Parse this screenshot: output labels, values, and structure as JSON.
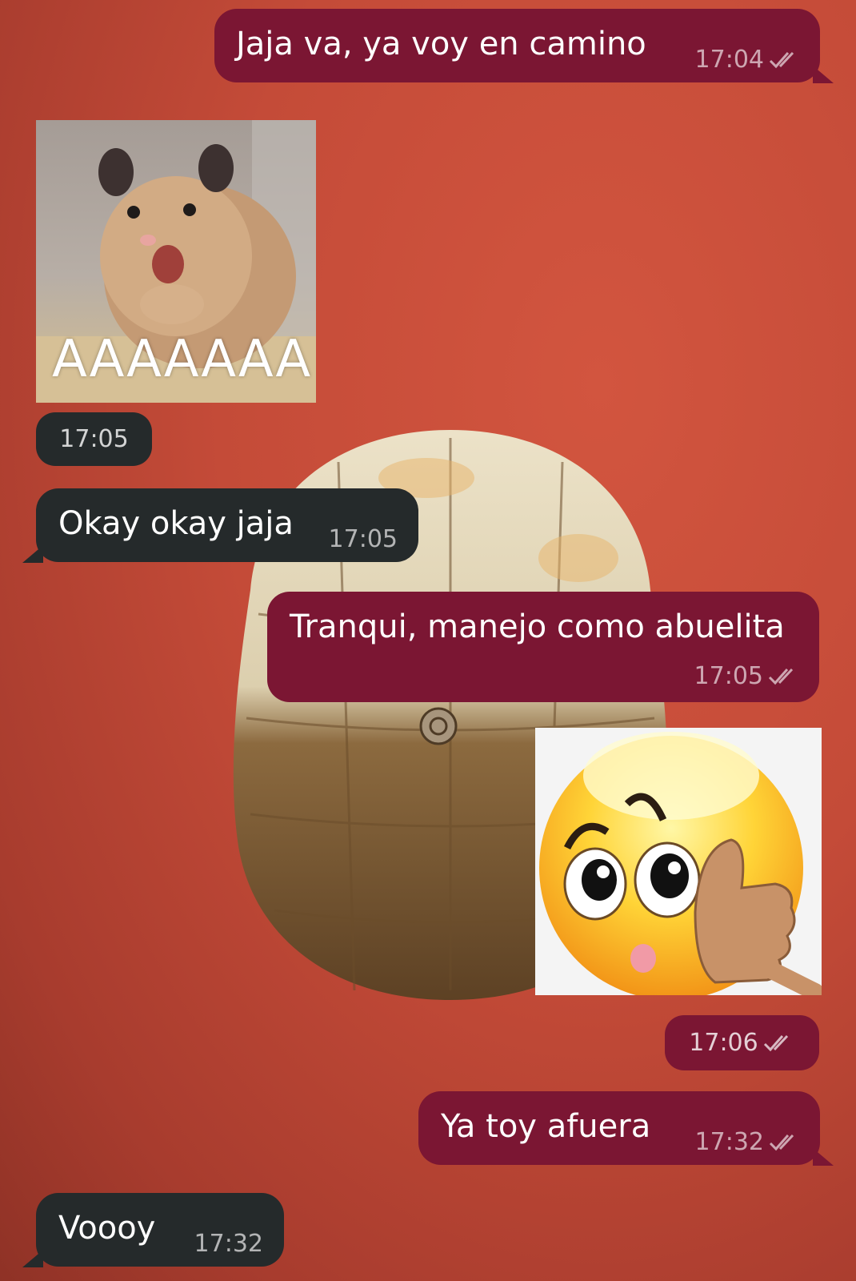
{
  "colors": {
    "outgoing_bubble": "#7b1633",
    "incoming_bubble": "#252a2b",
    "wallpaper": "#c44b38"
  },
  "messages": [
    {
      "direction": "outgoing",
      "text": "Jaja va, ya voy en camino",
      "time": "17:04",
      "status_icon": "double-check-icon"
    },
    {
      "direction": "incoming",
      "type": "sticker",
      "sticker_icon": "hamster-screaming-sticker",
      "caption": "AAAAAAA",
      "time": "17:05"
    },
    {
      "direction": "incoming",
      "text": "Okay okay jaja",
      "time": "17:05"
    },
    {
      "direction": "outgoing",
      "text": "Tranqui, manejo como abuelita",
      "time": "17:05",
      "status_icon": "double-check-icon"
    },
    {
      "direction": "outgoing",
      "type": "sticker",
      "sticker_icon": "emoji-call-me-hand-sticker",
      "time": "17:06",
      "status_icon": "double-check-icon"
    },
    {
      "direction": "outgoing",
      "text": "Ya toy afuera",
      "time": "17:32",
      "status_icon": "double-check-icon"
    },
    {
      "direction": "incoming",
      "text": "Voooy",
      "time": "17:32"
    }
  ],
  "wallpaper_icon": "turtle-shell-wallpaper"
}
